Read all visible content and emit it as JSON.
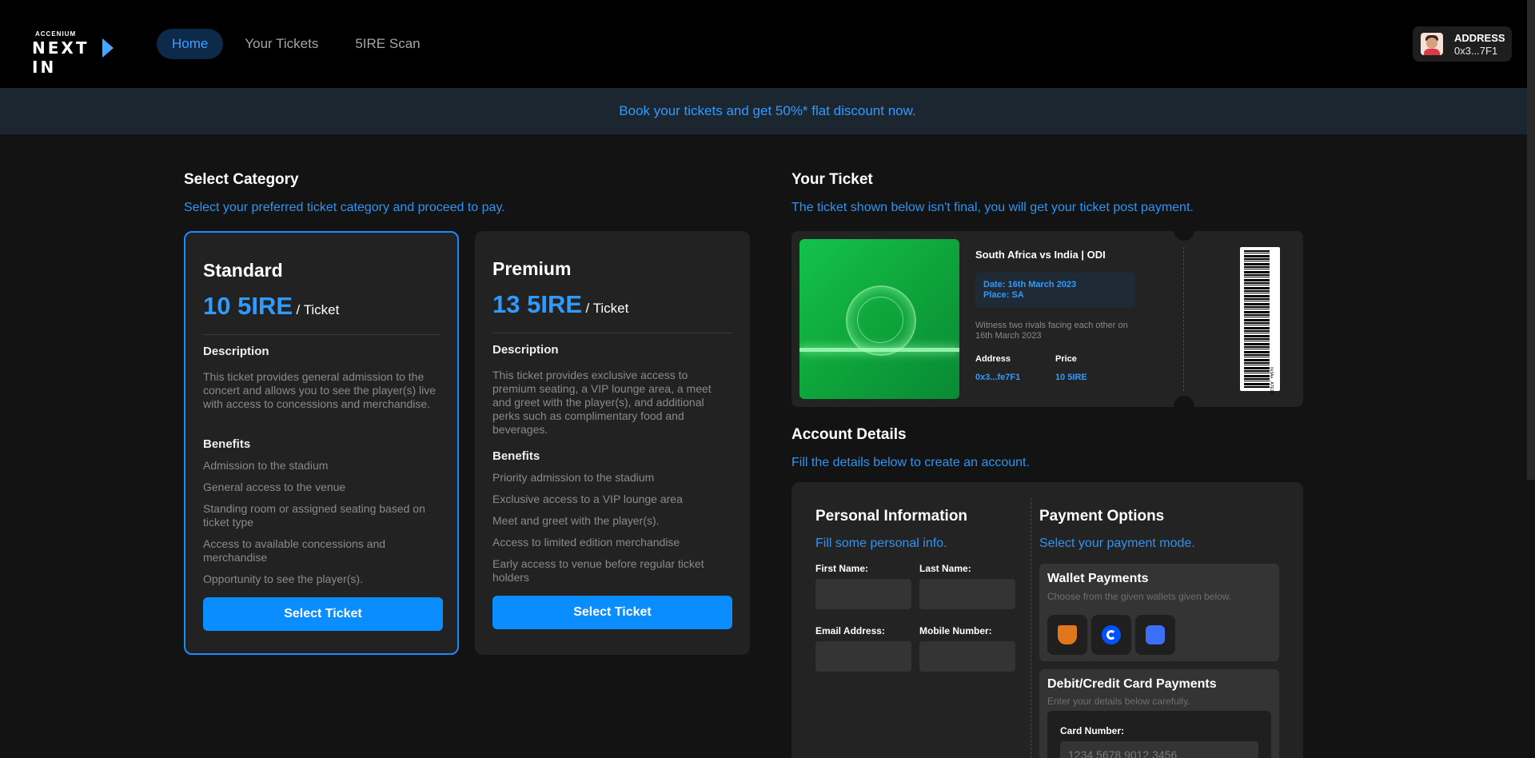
{
  "header": {
    "logo_small": "ACCENIUM",
    "logo_big": "NEXT IN",
    "nav": [
      {
        "label": "Home",
        "active": true
      },
      {
        "label": "Your Tickets",
        "active": false
      },
      {
        "label": "5IRE Scan",
        "active": false
      }
    ],
    "address_label": "ADDRESS",
    "address_value": "0x3...7F1"
  },
  "banner": "Book your tickets and get 50%* flat discount now.",
  "select_category": {
    "title": "Select Category",
    "subtitle": "Select your preferred ticket category and proceed to pay.",
    "cards": [
      {
        "name": "Standard",
        "price": "10 5IRE",
        "unit": "/ Ticket",
        "description_heading": "Description",
        "description": "This ticket provides general admission to the concert and allows you to see the player(s) live with access to concessions and merchandise.",
        "benefits_heading": "Benefits",
        "benefits": [
          "Admission to the stadium",
          "General access to the venue",
          "Standing room or assigned seating based on ticket type",
          "Access to available concessions and merchandise",
          "Opportunity to see the player(s)."
        ],
        "button": "Select Ticket",
        "selected": true
      },
      {
        "name": "Premium",
        "price": "13 5IRE",
        "unit": "/ Ticket",
        "description_heading": "Description",
        "description": "This ticket provides exclusive access to premium seating, a VIP lounge area, a meet and greet with the player(s), and additional perks such as complimentary food and beverages.",
        "benefits_heading": "Benefits",
        "benefits": [
          "Priority admission to the stadium",
          "Exclusive access to a VIP lounge area",
          "Meet and greet with the player(s).",
          "Access to limited edition merchandise",
          "Early access to venue before regular ticket holders"
        ],
        "button": "Select Ticket",
        "selected": false
      }
    ]
  },
  "your_ticket": {
    "title": "Your Ticket",
    "subtitle": "The ticket shown below isn't final, you will get your ticket post payment.",
    "match": "South Africa vs India | ODI",
    "date": "Date: 16th March 2023",
    "place": "Place: SA",
    "description": "Witness two rivals facing each other on 16th March 2023",
    "address_label": "Address",
    "address_value": "0x3...fe7F1",
    "price_label": "Price",
    "price_value": "10 5IRE",
    "barcode_text": "0x3Ae...A7E1F"
  },
  "account": {
    "title": "Account Details",
    "subtitle": "Fill the details below to create an account.",
    "personal": {
      "title": "Personal Information",
      "subtitle": "Fill some personal info.",
      "first_name": "First Name:",
      "last_name": "Last Name:",
      "email": "Email Address:",
      "mobile": "Mobile Number:"
    },
    "payment": {
      "title": "Payment Options",
      "subtitle": "Select your payment mode.",
      "wallet_title": "Wallet Payments",
      "wallet_sub": "Choose from the given wallets given below.",
      "wallets": [
        "metamask-icon",
        "coinbase-icon",
        "walletconnect-icon"
      ],
      "card_title": "Debit/Credit Card Payments",
      "card_sub": "Enter your details below carefully.",
      "card_number_label": "Card Number:",
      "card_number_placeholder": "1234 5678 9012 3456"
    }
  },
  "colors": {
    "accent": "#0a8dff",
    "link_blue": "#2f94f0",
    "background": "#131313",
    "card": "#222222"
  }
}
